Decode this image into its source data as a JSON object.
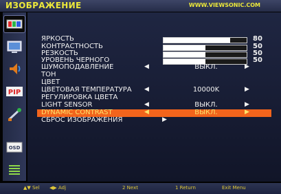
{
  "header": {
    "title": "ИЗОБРАЖЕНИЕ",
    "website": "WWW.VIEWSONIC.COM"
  },
  "sidebar": {
    "items": [
      {
        "icon": "picture-icon",
        "active": true
      },
      {
        "icon": "monitor-icon",
        "active": false
      },
      {
        "icon": "audio-icon",
        "active": false
      },
      {
        "icon": "pip-icon",
        "label": "PIP",
        "active": false
      },
      {
        "icon": "setup-tools-icon",
        "active": false
      },
      {
        "icon": "osd-icon",
        "label": "OSD",
        "active": false
      },
      {
        "icon": "menu-list-icon",
        "active": false
      }
    ]
  },
  "settings": [
    {
      "label": "ЯРКОСТЬ",
      "type": "slider",
      "value": 80
    },
    {
      "label": "КОНТРАСТНОСТЬ",
      "type": "slider",
      "value": 50
    },
    {
      "label": "РЕЗКОСТЬ",
      "type": "slider",
      "value": 50
    },
    {
      "label": "УРОВЕНЬ ЧЕРНОГО",
      "type": "slider",
      "value": 50
    },
    {
      "label": "ШУМОПОДАВЛЕНИЕ",
      "type": "select",
      "value": "ВЫКЛ."
    },
    {
      "label": "ТОН",
      "type": "text"
    },
    {
      "label": "ЦВЕТ",
      "type": "text"
    },
    {
      "label": "ЦВЕТОВАЯ ТЕМПЕРАТУРА",
      "type": "select",
      "value": "10000K"
    },
    {
      "label": "РЕГУЛИРОВКА ЦВЕТА",
      "type": "text"
    },
    {
      "label": "LIGHT SENSOR",
      "type": "select",
      "value": "ВЫКЛ."
    },
    {
      "label": "DYNAMIC CONTRAST",
      "type": "select",
      "value": "ВЫКЛ.",
      "selected": true
    },
    {
      "label": "СБРОС ИЗОБРАЖЕНИЯ",
      "type": "submenu"
    }
  ],
  "footer": {
    "sel": "▲▼ Sel",
    "adj": "◀▶ Adj",
    "next": "2 Next",
    "return": "1 Return",
    "exit": "Exit Menu"
  },
  "colors": {
    "accent": "#f2641c",
    "highlight_text": "#ffe36b",
    "title": "#ece83a"
  }
}
